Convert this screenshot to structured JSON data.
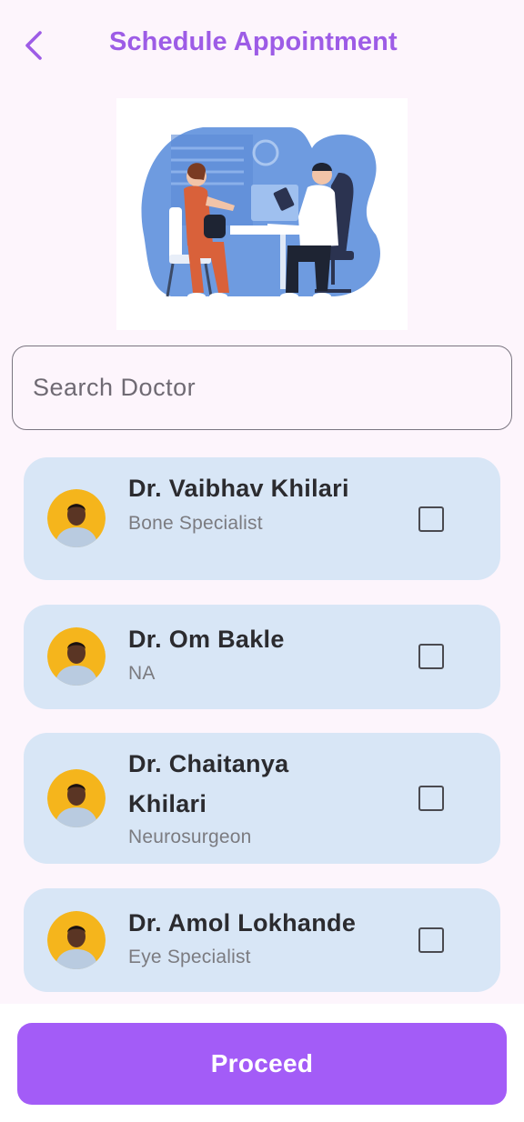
{
  "header": {
    "title": "Schedule Appointment",
    "back_icon": "chevron-left-icon"
  },
  "search": {
    "placeholder": "Search Doctor",
    "value": ""
  },
  "doctors": [
    {
      "name": "Dr. Vaibhav Khilari",
      "specialty": "Bone Specialist",
      "checked": false
    },
    {
      "name": "Dr. Om Bakle",
      "specialty": "NA",
      "checked": false
    },
    {
      "name": "Dr. Chaitanya Khilari",
      "specialty": "Neurosurgeon",
      "checked": false
    },
    {
      "name": "Dr. Amol Lokhande",
      "specialty": "Eye Specialist",
      "checked": false
    }
  ],
  "footer": {
    "proceed_label": "Proceed"
  },
  "colors": {
    "accent": "#9d5ce6",
    "button": "#a35cf7",
    "card": "#d8e6f6",
    "background": "#fdf5fc"
  }
}
